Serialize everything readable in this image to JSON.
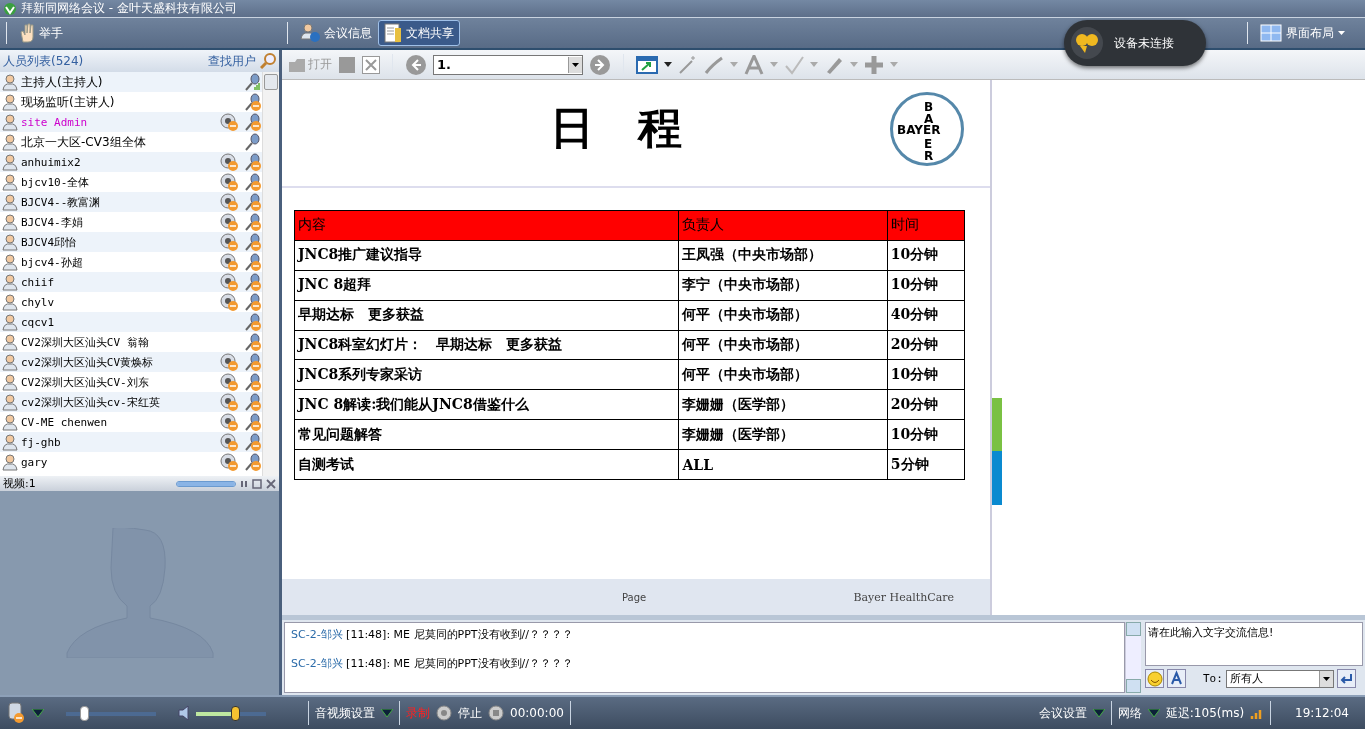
{
  "window": {
    "title": "拜新同网络会议 - 金叶天盛科技有限公司"
  },
  "toolbar": {
    "raise_hand": "举手",
    "tabs": [
      {
        "label": "会议信息",
        "selected": false
      },
      {
        "label": "文档共享",
        "selected": true
      }
    ],
    "device_status": "设备未连接",
    "layout_menu": "界面布局"
  },
  "people": {
    "title": "人员列表(524)",
    "find_user": "查找用户",
    "members": [
      {
        "name": "主持人(主持人)",
        "camera": false,
        "mic_signal": true,
        "mic_muted": false
      },
      {
        "name": "现场监听(主讲人)",
        "camera": false,
        "mic_signal": false,
        "mic_muted": true
      },
      {
        "name": "site Admin",
        "camera": true,
        "mic_signal": false,
        "mic_muted": true,
        "color": "#cc00cc"
      },
      {
        "name": "北京一大区-CV3组全体",
        "camera": false,
        "mic_signal": false,
        "mic_muted": false
      },
      {
        "name": "anhuimix2",
        "camera": true,
        "mic_signal": false,
        "mic_muted": true
      },
      {
        "name": "bjcv10-全体",
        "camera": true,
        "mic_signal": false,
        "mic_muted": true
      },
      {
        "name": "BJCV4--教富渊",
        "camera": true,
        "mic_signal": false,
        "mic_muted": true
      },
      {
        "name": "BJCV4-李娟",
        "camera": true,
        "mic_signal": false,
        "mic_muted": true
      },
      {
        "name": "BJCV4邱怡",
        "camera": true,
        "mic_signal": false,
        "mic_muted": true
      },
      {
        "name": "bjcv4-孙超",
        "camera": true,
        "mic_signal": false,
        "mic_muted": true
      },
      {
        "name": "chiif",
        "camera": true,
        "mic_signal": false,
        "mic_muted": true
      },
      {
        "name": "chylv",
        "camera": true,
        "mic_signal": false,
        "mic_muted": true
      },
      {
        "name": "cqcv1",
        "camera": false,
        "mic_signal": false,
        "mic_muted": true
      },
      {
        "name": "CV2深圳大区汕头CV 翁翰",
        "camera": false,
        "mic_signal": false,
        "mic_muted": true
      },
      {
        "name": "cv2深圳大区汕头CV黄焕标",
        "camera": true,
        "mic_signal": false,
        "mic_muted": true
      },
      {
        "name": "CV2深圳大区汕头CV-刘东",
        "camera": true,
        "mic_signal": false,
        "mic_muted": true
      },
      {
        "name": "cv2深圳大区汕头cv-宋红英",
        "camera": true,
        "mic_signal": false,
        "mic_muted": true
      },
      {
        "name": "CV-ME chenwen",
        "camera": true,
        "mic_signal": false,
        "mic_muted": true
      },
      {
        "name": "fj-ghb",
        "camera": true,
        "mic_signal": false,
        "mic_muted": true
      },
      {
        "name": "gary",
        "camera": true,
        "mic_signal": false,
        "mic_muted": true
      }
    ]
  },
  "video": {
    "title": "视频:1",
    "level": 1
  },
  "doc_toolbar": {
    "open": "打开",
    "page": "1."
  },
  "slide": {
    "title": "日　程",
    "logo": {
      "top": "BA",
      "horizontal": "BAYER",
      "bottom": "ER"
    },
    "columns": [
      "内容",
      "负责人",
      "时间"
    ],
    "rows": [
      [
        "JNC8推广建议指导",
        "王凤强（中央市场部）",
        "10分钟"
      ],
      [
        "JNC 8超拜",
        "李宁（中央市场部）",
        "10分钟"
      ],
      [
        "早期达标　更多获益",
        "何平（中央市场部）",
        "40分钟"
      ],
      [
        "JNC8科室幻灯片：　早期达标　更多获益",
        "何平（中央市场部）",
        "20分钟"
      ],
      [
        "JNC8系列专家采访",
        "何平（中央市场部）",
        "10分钟"
      ],
      [
        "JNC 8解读:我们能从JNC8借鉴什么",
        "李姗姗（医学部）",
        "20分钟"
      ],
      [
        "常见问题解答",
        "李姗姗（医学部）",
        "10分钟"
      ],
      [
        "自测考试",
        "ALL",
        "5分钟"
      ]
    ],
    "footer_page": "Page",
    "footer_brand": "Bayer HealthCare"
  },
  "chat": {
    "messages": [
      {
        "sender": "SC-2-邹兴",
        "time": "[11:48]:",
        "text": "ME 尼莫同的PPT没有收到//？？？？"
      },
      {
        "sender": "SC-2-邹兴",
        "time": "[11:48]:",
        "text": "ME 尼莫同的PPT没有收到//？？？？"
      }
    ],
    "input_placeholder": "请在此输入文字交流信息!",
    "to_label": "To:",
    "recipient": "所有人"
  },
  "status_bar": {
    "mic_slider": {
      "level": 0.2
    },
    "volume_slider": {
      "level": 0.55
    },
    "av_settings": "音视频设置",
    "record": "录制",
    "stop": "停止",
    "timer": "00:00:00",
    "meeting_settings": "会议设置",
    "network": "网络",
    "latency": "延迟:105(ms)",
    "clock": "19:12:04"
  }
}
